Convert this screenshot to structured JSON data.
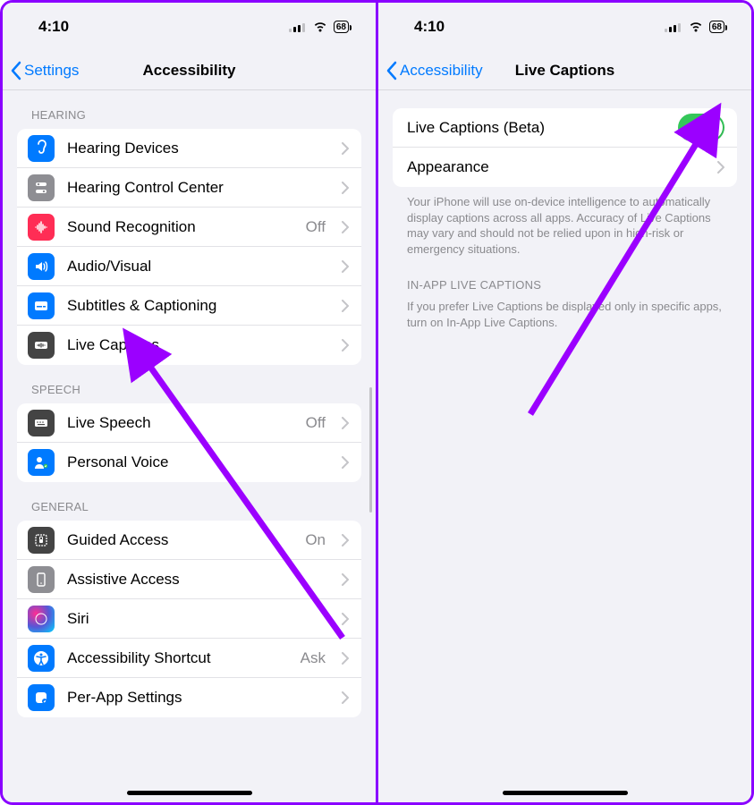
{
  "statusbar": {
    "time": "4:10",
    "battery": "68"
  },
  "left": {
    "back": "Settings",
    "title": "Accessibility",
    "sections": {
      "hearing": {
        "header": "HEARING",
        "items": [
          {
            "label": "Hearing Devices"
          },
          {
            "label": "Hearing Control Center"
          },
          {
            "label": "Sound Recognition",
            "detail": "Off"
          },
          {
            "label": "Audio/Visual"
          },
          {
            "label": "Subtitles & Captioning"
          },
          {
            "label": "Live Captions"
          }
        ]
      },
      "speech": {
        "header": "SPEECH",
        "items": [
          {
            "label": "Live Speech",
            "detail": "Off"
          },
          {
            "label": "Personal Voice"
          }
        ]
      },
      "general": {
        "header": "GENERAL",
        "items": [
          {
            "label": "Guided Access",
            "detail": "On"
          },
          {
            "label": "Assistive Access"
          },
          {
            "label": "Siri"
          },
          {
            "label": "Accessibility Shortcut",
            "detail": "Ask"
          },
          {
            "label": "Per-App Settings"
          }
        ]
      }
    }
  },
  "right": {
    "back": "Accessibility",
    "title": "Live Captions",
    "items": {
      "toggle": "Live Captions (Beta)",
      "appearance": "Appearance"
    },
    "footer1": "Your iPhone will use on-device intelligence to automatically display captions across all apps. Accuracy of Live Captions may vary and should not be relied upon in high-risk or emergency situations.",
    "section2_header": "IN-APP LIVE CAPTIONS",
    "footer2": "If you prefer Live Captions be displayed only in specific apps, turn on In-App Live Captions."
  }
}
